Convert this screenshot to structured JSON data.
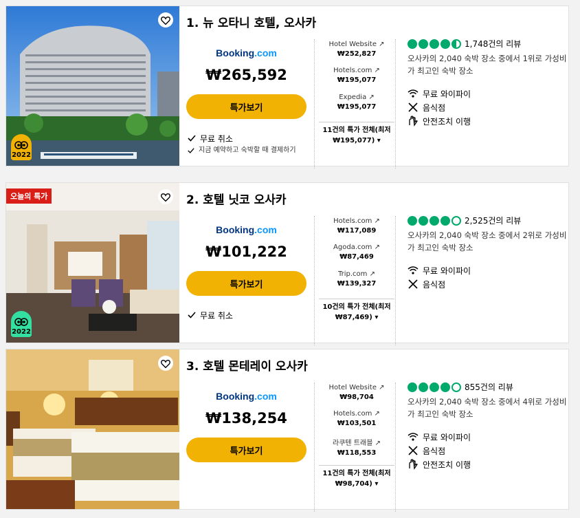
{
  "hotels": [
    {
      "title": "1. 뉴 오타니 호텔, 오사카",
      "badge_year": "2022",
      "booking_logo": {
        "part1": "Booking",
        "part2": ".com"
      },
      "price": "₩265,592",
      "deal_button": "특가보기",
      "perks": [
        "무료 취소"
      ],
      "perk_small": "지금 예약하고 숙박할 때 결제하기",
      "providers": [
        {
          "name": "Hotel Website",
          "price": "₩252,827"
        },
        {
          "name": "Hotels.com",
          "price": "₩195,077"
        },
        {
          "name": "Expedia",
          "price": "₩195,077"
        }
      ],
      "all_deals_line1": "11건의 특가 전체(최저",
      "all_deals_line2": "₩195,077)",
      "rating": 4.5,
      "reviews": "1,748건의 리뷰",
      "rank": "오사카의 2,040 숙박 장소 중에서 1위로 가성비가 최고인 숙박 장소",
      "amenities": [
        "무료 와이파이",
        "음식점",
        "안전조치 이행"
      ]
    },
    {
      "title": "2. 호텔 닛코 오사카",
      "deal_tag": "오늘의 특가",
      "badge_year": "2022",
      "booking_logo": {
        "part1": "Booking",
        "part2": ".com"
      },
      "price": "₩101,222",
      "deal_button": "특가보기",
      "perks": [
        "무료 취소"
      ],
      "providers": [
        {
          "name": "Hotels.com",
          "price": "₩117,089"
        },
        {
          "name": "Agoda.com",
          "price": "₩87,469"
        },
        {
          "name": "Trip.com",
          "price": "₩139,327"
        }
      ],
      "all_deals_line1": "10건의 특가 전체(최저",
      "all_deals_line2": "₩87,469)",
      "rating": 4,
      "reviews": "2,525건의 리뷰",
      "rank": "오사카의 2,040 숙박 장소 중에서 2위로 가성비가 최고인 숙박 장소",
      "amenities": [
        "무료 와이파이",
        "음식점"
      ]
    },
    {
      "title": "3. 호텔 몬테레이 오사카",
      "booking_logo": {
        "part1": "Booking",
        "part2": ".com"
      },
      "price": "₩138,254",
      "deal_button": "특가보기",
      "providers": [
        {
          "name": "Hotel Website",
          "price": "₩98,704"
        },
        {
          "name": "Hotels.com",
          "price": "₩103,501"
        },
        {
          "name": "라쿠텐 트래블",
          "price": "₩118,553"
        }
      ],
      "all_deals_line1": "11건의 특가 전체(최저",
      "all_deals_line2": "₩98,704)",
      "rating": 4,
      "reviews": "855건의 리뷰",
      "rank": "오사카의 2,040 숙박 장소 중에서 4위로 가성비가 최고인 숙박 장소",
      "amenities": [
        "무료 와이파이",
        "음식점",
        "안전조치 이행"
      ]
    }
  ],
  "colors": {
    "accent": "#f2b203",
    "rating": "#00aa6c",
    "deal_tag": "#d91e18",
    "badge_green": "#34e0a1"
  },
  "icons": [
    "heart-icon",
    "external-link-icon",
    "chevron-down-icon",
    "check-icon",
    "wifi-icon",
    "restaurant-icon",
    "safety-hand-icon",
    "tripadvisor-owl-icon"
  ]
}
